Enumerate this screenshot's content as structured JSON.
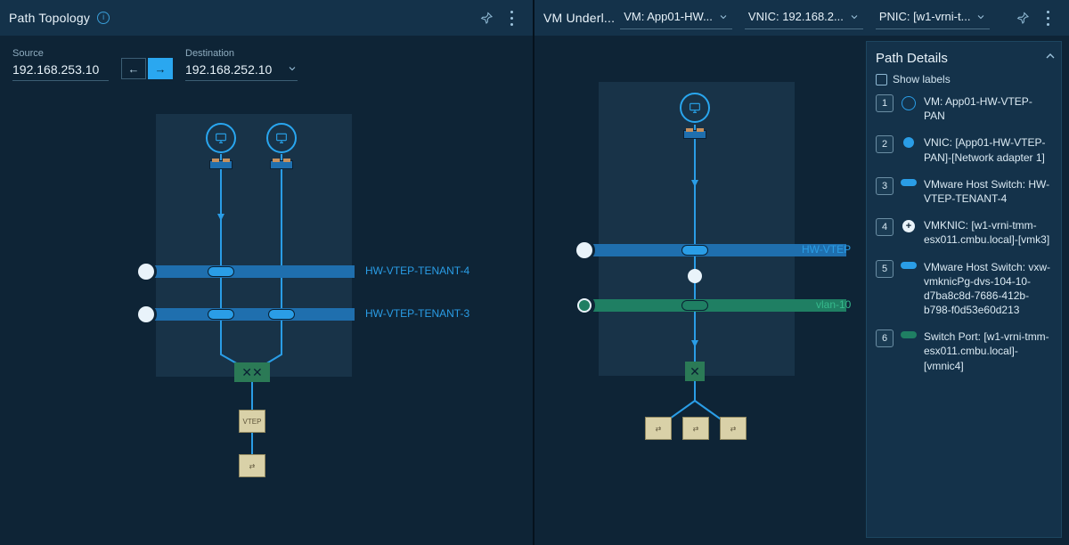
{
  "left": {
    "title": "Path Topology",
    "source_label": "Source",
    "source_value": "192.168.253.10",
    "dest_label": "Destination",
    "dest_value": "192.168.252.10",
    "tenant4_label": "HW-VTEP-TENANT-4",
    "tenant3_label": "HW-VTEP-TENANT-3",
    "vtep_box": "VTEP"
  },
  "right": {
    "title": "VM Underl...",
    "dd_vm": "VM: App01-HW...",
    "dd_vnic": "VNIC: 192.168.2...",
    "dd_pnic": "PNIC: [w1-vrni-t...",
    "hw_label": "HW-VTEP",
    "vlan_label": "vlan-10"
  },
  "details": {
    "title": "Path Details",
    "show_labels": "Show labels",
    "steps": [
      {
        "n": "1",
        "ico": "vm",
        "txt": "VM: App01-HW-VTEP-PAN"
      },
      {
        "n": "2",
        "ico": "dot",
        "txt": "VNIC: [App01-HW-VTEP-PAN]-[Network adapter 1]"
      },
      {
        "n": "3",
        "ico": "pill",
        "txt": "VMware Host Switch: HW-VTEP-TENANT-4"
      },
      {
        "n": "4",
        "ico": "plus",
        "txt": "VMKNIC: [w1-vrni-tmm-esx011.cmbu.local]-[vmk3]"
      },
      {
        "n": "5",
        "ico": "pill",
        "txt": "VMware Host Switch: vxw-vmknicPg-dvs-104-10-d7ba8c8d-7686-412b-b798-f0d53e60d213"
      },
      {
        "n": "6",
        "ico": "pillg",
        "txt": "Switch Port: [w1-vrni-tmm-esx011.cmbu.local]-[vmnic4]"
      }
    ]
  }
}
